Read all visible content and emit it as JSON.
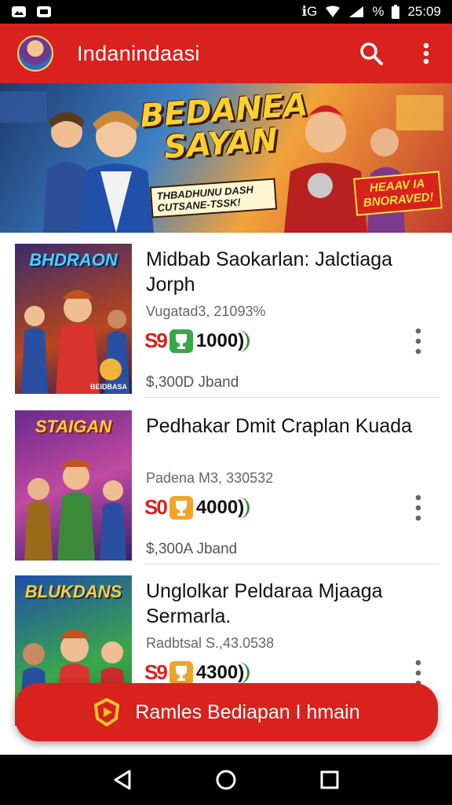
{
  "status_bar": {
    "time": "25:09",
    "signal": "ℹG",
    "battery": "%"
  },
  "app_bar": {
    "title": "Indanindaasi"
  },
  "banner": {
    "title": "BEDANEA SAYAN",
    "subtitle": "THBADHUNU DASH CUTSANE-TSSK!",
    "badge": "HEAAV IA BNORAVED!"
  },
  "items": [
    {
      "thumb_title": "BHDRAON",
      "thumb_foot": "BEIDBASA",
      "title": "Midbab Saokarlan: Jalctiaga Jorph",
      "subtitle": "Vugatad3, 21093%",
      "age": "S9",
      "rating": "1000)",
      "price": "$,300D Jband"
    },
    {
      "thumb_title": "STAIGAN",
      "thumb_foot": "",
      "title": "Pedhakar Dmit Craplan Kuada",
      "subtitle": "Padena M3, 330532",
      "age": "S0",
      "rating": "4000)",
      "price": "$,300A Jband"
    },
    {
      "thumb_title": "BLUKDANS",
      "thumb_foot": "",
      "title": "Unglolkar Peldaraa Mjaaga Sermarla.",
      "subtitle": "Radbtsal S.,43.0538",
      "age": "S9",
      "rating": "4300)",
      "price": ""
    }
  ],
  "cta": {
    "label": "Ramles Bediapan I hmain"
  },
  "colors": {
    "primary": "#d9211e",
    "status_bg": "#000000",
    "rating_green": "#3aa64a",
    "rating_gold": "#f0a52a"
  },
  "icons": [
    "search-icon",
    "more-vert-icon",
    "back-icon",
    "home-icon",
    "recents-icon",
    "shield-icon"
  ]
}
